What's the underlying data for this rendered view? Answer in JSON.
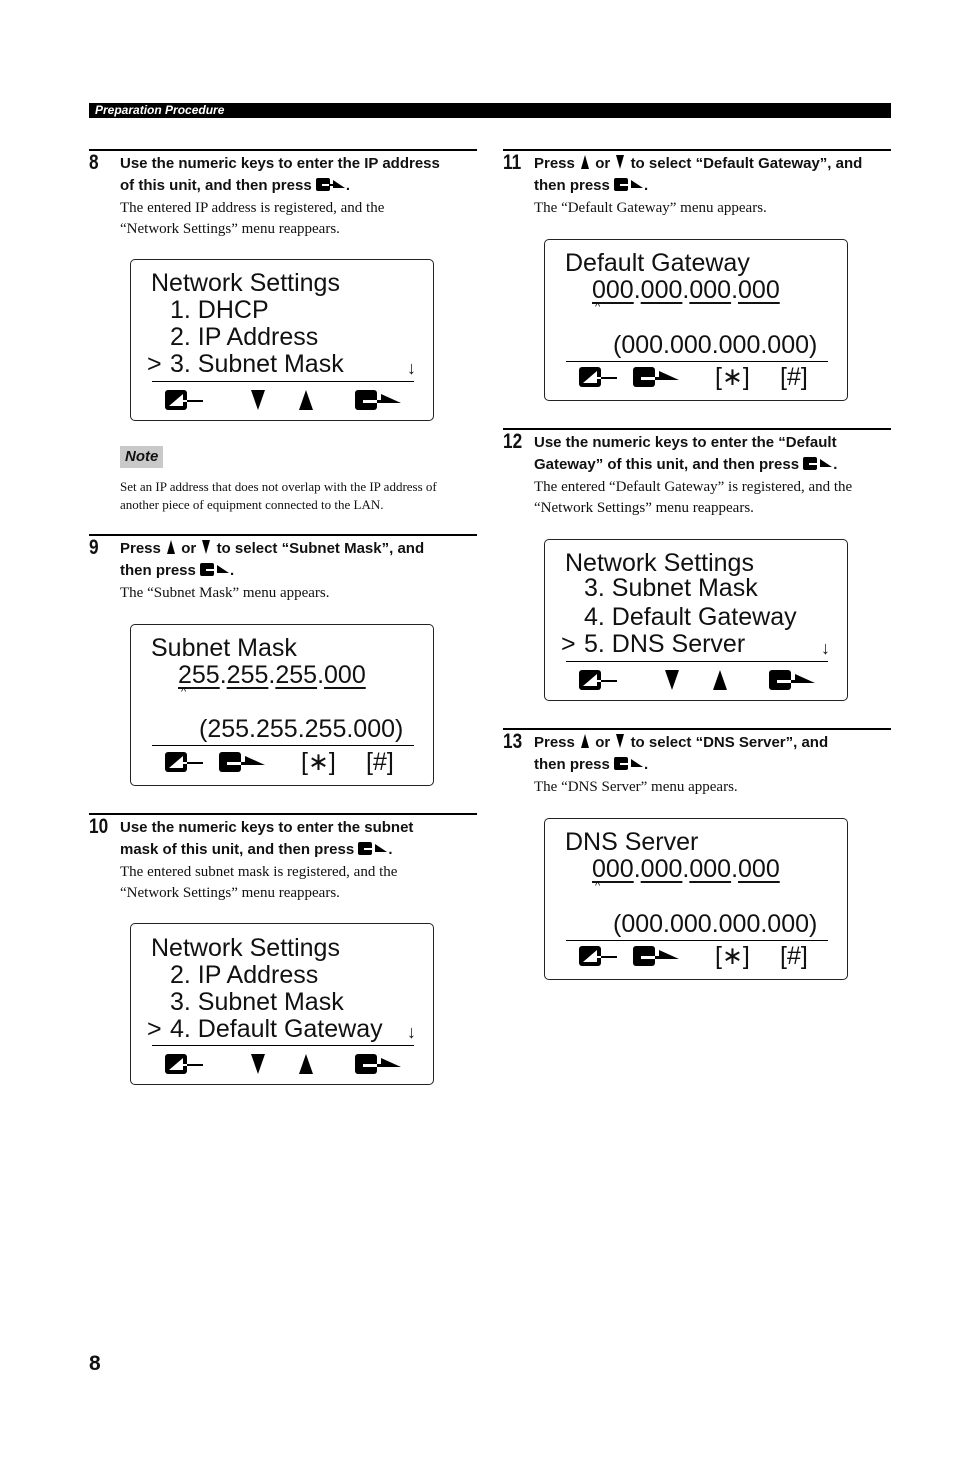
{
  "header": {
    "section": "Preparation Procedure"
  },
  "steps": {
    "s8": {
      "number": "8",
      "title_l1": "Use the numeric keys to enter the IP address",
      "title_l2": "of this unit, and then press",
      "desc_l1": "The entered IP address is registered, and the",
      "desc_l2": "“Network Settings” menu reappears."
    },
    "s9": {
      "number": "9",
      "title_a": "Press",
      "title_b": "or",
      "title_c": "to select “Subnet Mask”, and",
      "title_l2": "then press",
      "desc_l1": "The “Subnet Mask” menu appears."
    },
    "s10": {
      "number": "10",
      "title_l1": "Use the numeric keys to enter the subnet",
      "title_l2": "mask of this unit, and then press",
      "desc_l1": "The entered subnet mask is registered, and the",
      "desc_l2": "“Network Settings” menu reappears."
    },
    "s11": {
      "number": "11",
      "title_a": "Press",
      "title_b": "or",
      "title_c": "to select “Default Gateway”, and",
      "title_l2": "then press",
      "desc_l1": "The “Default Gateway” menu appears."
    },
    "s12": {
      "number": "12",
      "title_l1": "Use the numeric keys to enter the “Default",
      "title_l2": "Gateway” of this unit, and then press",
      "desc_l1": "The entered “Default Gateway” is registered, and the",
      "desc_l2": "“Network Settings” menu reappears."
    },
    "s13": {
      "number": "13",
      "title_a": "Press",
      "title_b": "or",
      "title_c": "to select “DNS Server”, and",
      "title_l2": "then press",
      "desc_l1": "The “DNS Server” menu appears."
    }
  },
  "note": {
    "label": "Note",
    "text": "Set an IP address that does not overlap with the IP address of another piece of equipment connected to the LAN."
  },
  "screens": {
    "menu1": {
      "title": "Network Settings",
      "items": [
        "1. DHCP",
        "2. IP Address",
        "3. Subnet Mask"
      ],
      "selected_marker": ">",
      "scroll": "↓"
    },
    "subnet": {
      "title": "Subnet Mask",
      "octets": [
        "255",
        "255",
        "255",
        "000"
      ],
      "current": "(255.255.255.000)",
      "star": "[∗]",
      "hash": "[#]"
    },
    "menu2": {
      "title": "Network Settings",
      "items": [
        "2. IP Address",
        "3. Subnet Mask",
        "4. Default Gateway"
      ],
      "selected_marker": ">",
      "scroll": "↓"
    },
    "gateway": {
      "title": "Default Gateway",
      "octets": [
        "000",
        "000",
        "000",
        "000"
      ],
      "current": "(000.000.000.000)",
      "star": "[∗]",
      "hash": "[#]"
    },
    "menu3": {
      "title": "Network Settings",
      "items": [
        "3. Subnet Mask",
        "4. Default Gateway",
        "5. DNS Server"
      ],
      "selected_marker": ">",
      "scroll": "↓"
    },
    "dns": {
      "title": "DNS Server",
      "octets": [
        "000",
        "000",
        "000",
        "000"
      ],
      "current": "(000.000.000.000)",
      "star": "[∗]",
      "hash": "[#]"
    }
  },
  "caret": "^",
  "dot": ".",
  "page_number": "8"
}
